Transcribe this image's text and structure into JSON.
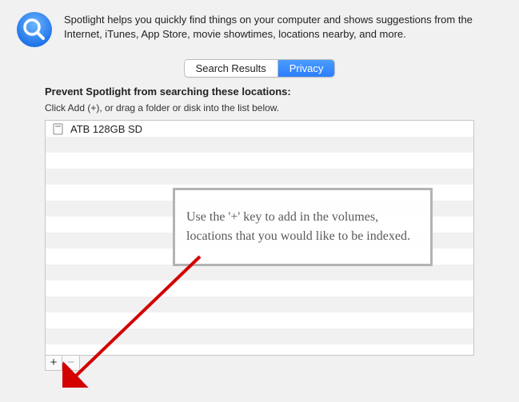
{
  "header": {
    "description": "Spotlight helps you quickly find things on your computer and shows suggestions from the Internet, iTunes, App Store, movie showtimes, locations nearby, and more."
  },
  "tabs": {
    "search_results": "Search Results",
    "privacy": "Privacy"
  },
  "section": {
    "title": "Prevent Spotlight from searching these locations:",
    "subtitle": "Click Add (+), or drag a folder or disk into the list below."
  },
  "locations": [
    {
      "name": "ATB 128GB SD"
    }
  ],
  "buttons": {
    "add": "+",
    "remove": "−"
  },
  "annotation": {
    "text": "Use the '+' key to add in the volumes, locations that you would like to be indexed."
  }
}
